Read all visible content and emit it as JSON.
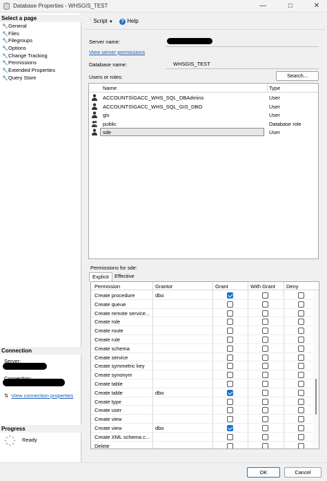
{
  "window": {
    "title": "Database Properties - WHSGIS_TEST"
  },
  "left_pane": {
    "select_page_label": "Select a page",
    "pages": [
      "General",
      "Files",
      "Filegroups",
      "Options",
      "Change Tracking",
      "Permissions",
      "Extended Properties",
      "Query Store"
    ],
    "connection_label": "Connection",
    "server_label": "Server:",
    "connection_field_label": "Connection:",
    "view_connection_properties": "View connection properties",
    "progress_label": "Progress",
    "progress_status": "Ready"
  },
  "toolbar": {
    "script_label": "Script",
    "help_label": "Help"
  },
  "form": {
    "server_name_label": "Server name:",
    "view_server_permissions": "View server permissions",
    "database_name_label": "Database name:",
    "database_name_value": "WHSGIS_TEST",
    "users_or_roles_label": "Users or roles:",
    "search_button": "Search..."
  },
  "users_grid": {
    "columns": [
      "Name",
      "Type"
    ],
    "rows": [
      {
        "name": "ACCOUNTS\\GACC_WHS_SQL_DBAdmins",
        "type": "User",
        "icon": "user-icon"
      },
      {
        "name": "ACCOUNTS\\GACC_WHS_SQL_GIS_DBO",
        "type": "User",
        "icon": "user-icon"
      },
      {
        "name": "gis",
        "type": "User",
        "icon": "user-icon"
      },
      {
        "name": "public",
        "type": "Database role",
        "icon": "role-icon"
      },
      {
        "name": "sde",
        "type": "User",
        "icon": "user-icon",
        "selected": true
      }
    ]
  },
  "permissions": {
    "label": "Permissions for sde:",
    "tabs": [
      "Explicit",
      "Effective"
    ],
    "columns": [
      "Permission",
      "Grantor",
      "Grant",
      "With Grant",
      "Deny"
    ],
    "rows": [
      {
        "permission": "Create procedure",
        "grantor": "dbo",
        "grant": true,
        "with_grant": false,
        "deny": false
      },
      {
        "permission": "Create queue",
        "grantor": "",
        "grant": false,
        "with_grant": false,
        "deny": false
      },
      {
        "permission": "Create remote service...",
        "grantor": "",
        "grant": false,
        "with_grant": false,
        "deny": false
      },
      {
        "permission": "Create role",
        "grantor": "",
        "grant": false,
        "with_grant": false,
        "deny": false
      },
      {
        "permission": "Create route",
        "grantor": "",
        "grant": false,
        "with_grant": false,
        "deny": false
      },
      {
        "permission": "Create rule",
        "grantor": "",
        "grant": false,
        "with_grant": false,
        "deny": false
      },
      {
        "permission": "Create schema",
        "grantor": "",
        "grant": false,
        "with_grant": false,
        "deny": false
      },
      {
        "permission": "Create service",
        "grantor": "",
        "grant": false,
        "with_grant": false,
        "deny": false
      },
      {
        "permission": "Create symmetric key",
        "grantor": "",
        "grant": false,
        "with_grant": false,
        "deny": false
      },
      {
        "permission": "Create synonym",
        "grantor": "",
        "grant": false,
        "with_grant": false,
        "deny": false
      },
      {
        "permission": "Create table",
        "grantor": "",
        "grant": false,
        "with_grant": false,
        "deny": false
      },
      {
        "permission": "Create table",
        "grantor": "dbo",
        "grant": true,
        "with_grant": false,
        "deny": false
      },
      {
        "permission": "Create type",
        "grantor": "",
        "grant": false,
        "with_grant": false,
        "deny": false
      },
      {
        "permission": "Create user",
        "grantor": "",
        "grant": false,
        "with_grant": false,
        "deny": false
      },
      {
        "permission": "Create view",
        "grantor": "",
        "grant": false,
        "with_grant": false,
        "deny": false
      },
      {
        "permission": "Create view",
        "grantor": "dbo",
        "grant": true,
        "with_grant": false,
        "deny": false
      },
      {
        "permission": "Create XML schema c...",
        "grantor": "",
        "grant": false,
        "with_grant": false,
        "deny": false
      },
      {
        "permission": "Delete",
        "grantor": "",
        "grant": false,
        "with_grant": false,
        "deny": false
      }
    ]
  },
  "buttons": {
    "ok": "OK",
    "cancel": "Cancel"
  },
  "colors": {
    "link": "#1a5fb4",
    "checkbox_checked": "#1f6fd1",
    "selection_border": "#8a8a8a"
  }
}
